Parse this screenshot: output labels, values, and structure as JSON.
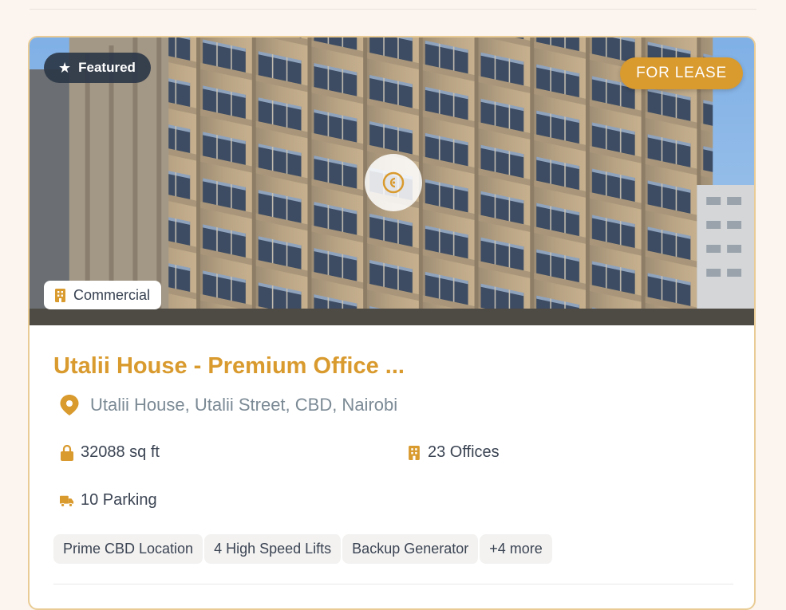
{
  "card": {
    "badges": {
      "featured_icon": "star-icon",
      "featured_label": "Featured",
      "listing_type": "FOR LEASE",
      "property_type_icon": "building-icon",
      "property_type": "Commercial"
    },
    "media": {
      "center_icon": "view-icon"
    },
    "title": "Utalii House - Premium Office ...",
    "location": {
      "icon": "map-pin-icon",
      "text": "Utalii House, Utalii Street, CBD, Nairobi"
    },
    "stats": {
      "area": {
        "icon": "lock-icon",
        "text": "32088 sq ft"
      },
      "offices": {
        "icon": "building-icon",
        "text": "23 Offices"
      },
      "parking": {
        "icon": "truck-icon",
        "text": "10 Parking"
      }
    },
    "amenities": [
      "Prime CBD Location",
      "4 High Speed Lifts",
      "Backup Generator",
      "+4 more"
    ]
  },
  "colors": {
    "page_background": "#fcf4ee",
    "accent": "#d99a2e",
    "card_border": "#e9cc95",
    "featured_badge": "#2d3748",
    "muted_text": "#7b8a95",
    "body_text": "#3b4453"
  }
}
